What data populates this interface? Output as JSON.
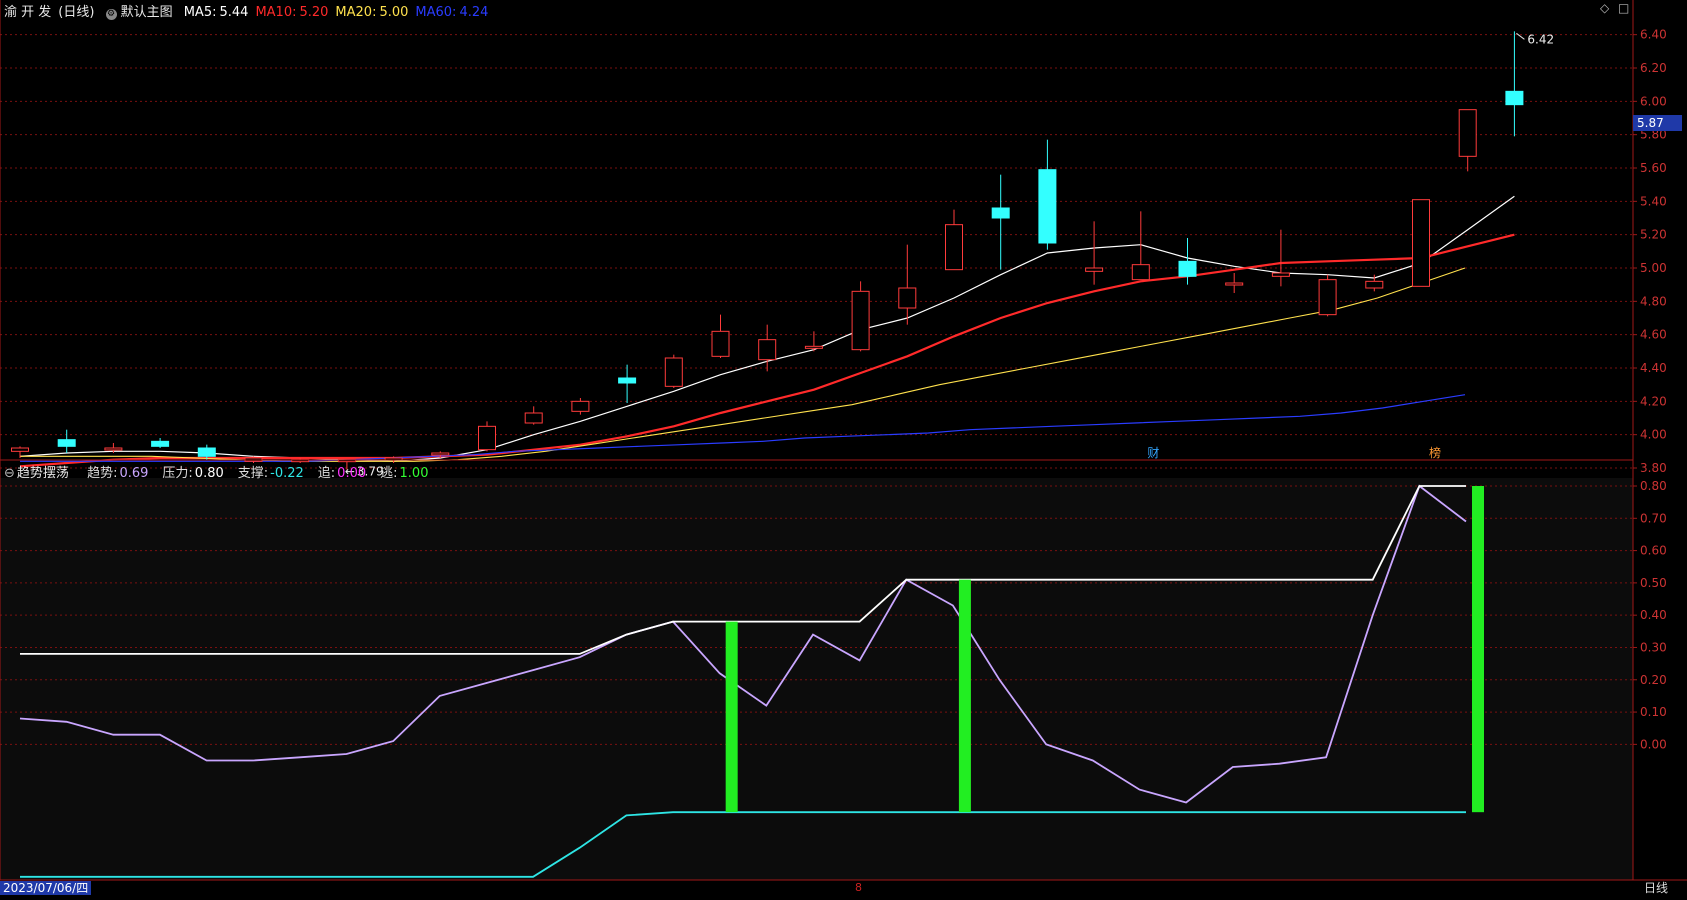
{
  "header": {
    "stock_name": "渝 开 发",
    "period": "(日线)",
    "template": "默认主图",
    "ma": [
      {
        "label": "MA5:",
        "value": "5.44",
        "color": "#ffffff"
      },
      {
        "label": "MA10:",
        "value": "5.20",
        "color": "#ff2a2a"
      },
      {
        "label": "MA20:",
        "value": "5.00",
        "color": "#ffe14d"
      },
      {
        "label": "MA60:",
        "value": "4.24",
        "color": "#2a3cff"
      }
    ]
  },
  "indicator_header": {
    "name": "趋势摆荡",
    "items": [
      {
        "label": "趋势:",
        "value": "0.69",
        "color": "#c9a6ff"
      },
      {
        "label": "压力:",
        "value": "0.80",
        "color": "#ffffff"
      },
      {
        "label": "支撑:",
        "value": "-0.22",
        "color": "#2ee6e6"
      },
      {
        "label": "追:",
        "value": "0.00",
        "color": "#ff33ff"
      },
      {
        "label": "逃:",
        "value": "1.00",
        "color": "#33ff33"
      }
    ]
  },
  "bottom_bar": {
    "date": "2023/07/06/四",
    "mid_label": "8",
    "period_button": "日线"
  },
  "window_icons": {
    "diamond": "◇",
    "square": "□"
  },
  "colors": {
    "up": "#ff3b3b",
    "down": "#33ffff",
    "bg": "#000000",
    "sub_bg": "#0c0c0c",
    "grid": "#7a1010"
  },
  "chart_data": [
    {
      "type": "candlestick",
      "title": "",
      "ylim": [
        3.74,
        6.5
      ],
      "y_ticks": [
        "6.40",
        "6.20",
        "6.00",
        "5.80",
        "5.60",
        "5.40",
        "5.20",
        "5.00",
        "4.80",
        "4.60",
        "4.40",
        "4.20",
        "4.00",
        "3.80"
      ],
      "current_price": "5.87",
      "annotations": [
        {
          "text": "6.42",
          "type": "high_marker"
        },
        {
          "text": "3.79",
          "type": "low_marker"
        },
        {
          "text": "财",
          "type": "event"
        },
        {
          "text": "榜",
          "type": "event"
        }
      ],
      "candles": [
        {
          "o": 3.9,
          "h": 3.93,
          "l": 3.86,
          "c": 3.92
        },
        {
          "o": 3.97,
          "h": 4.03,
          "l": 3.89,
          "c": 3.93
        },
        {
          "o": 3.91,
          "h": 3.95,
          "l": 3.89,
          "c": 3.92
        },
        {
          "o": 3.96,
          "h": 3.98,
          "l": 3.92,
          "c": 3.93
        },
        {
          "o": 3.92,
          "h": 3.94,
          "l": 3.85,
          "c": 3.87
        },
        {
          "o": 3.84,
          "h": 3.87,
          "l": 3.83,
          "c": 3.86
        },
        {
          "o": 3.85,
          "h": 3.86,
          "l": 3.83,
          "c": 3.85
        },
        {
          "o": 3.84,
          "h": 3.85,
          "l": 3.79,
          "c": 3.85
        },
        {
          "o": 3.85,
          "h": 3.87,
          "l": 3.83,
          "c": 3.86
        },
        {
          "o": 3.88,
          "h": 3.9,
          "l": 3.86,
          "c": 3.89
        },
        {
          "o": 3.91,
          "h": 4.08,
          "l": 3.9,
          "c": 4.05
        },
        {
          "o": 4.07,
          "h": 4.17,
          "l": 4.06,
          "c": 4.13
        },
        {
          "o": 4.14,
          "h": 4.22,
          "l": 4.12,
          "c": 4.2
        },
        {
          "o": 4.34,
          "h": 4.42,
          "l": 4.19,
          "c": 4.31
        },
        {
          "o": 4.29,
          "h": 4.48,
          "l": 4.28,
          "c": 4.46
        },
        {
          "o": 4.47,
          "h": 4.72,
          "l": 4.46,
          "c": 4.62
        },
        {
          "o": 4.45,
          "h": 4.66,
          "l": 4.38,
          "c": 4.57
        },
        {
          "o": 4.52,
          "h": 4.62,
          "l": 4.5,
          "c": 4.53
        },
        {
          "o": 4.51,
          "h": 4.92,
          "l": 4.5,
          "c": 4.86
        },
        {
          "o": 4.76,
          "h": 5.14,
          "l": 4.66,
          "c": 4.88
        },
        {
          "o": 4.99,
          "h": 5.35,
          "l": 4.99,
          "c": 5.26
        },
        {
          "o": 5.36,
          "h": 5.56,
          "l": 4.99,
          "c": 5.3
        },
        {
          "o": 5.59,
          "h": 5.77,
          "l": 5.11,
          "c": 5.15
        },
        {
          "o": 4.98,
          "h": 5.28,
          "l": 4.9,
          "c": 5.0
        },
        {
          "o": 4.93,
          "h": 5.34,
          "l": 4.93,
          "c": 5.02
        },
        {
          "o": 5.04,
          "h": 5.18,
          "l": 4.9,
          "c": 4.95
        },
        {
          "o": 4.91,
          "h": 4.97,
          "l": 4.85,
          "c": 4.91
        },
        {
          "o": 4.95,
          "h": 5.23,
          "l": 4.89,
          "c": 4.97
        },
        {
          "o": 4.72,
          "h": 4.96,
          "l": 4.71,
          "c": 4.93
        },
        {
          "o": 4.88,
          "h": 4.96,
          "l": 4.86,
          "c": 4.92
        },
        {
          "o": 4.89,
          "h": 5.41,
          "l": 4.89,
          "c": 5.41
        },
        {
          "o": 5.67,
          "h": 5.95,
          "l": 5.58,
          "c": 5.95
        },
        {
          "o": 6.06,
          "h": 6.42,
          "l": 5.79,
          "c": 5.98
        }
      ],
      "series": [
        {
          "name": "MA5",
          "color": "#ffffff",
          "width": 1.2,
          "values": [
            3.87,
            3.89,
            3.9,
            3.9,
            3.89,
            3.87,
            3.86,
            3.85,
            3.84,
            3.86,
            3.91,
            4.0,
            4.08,
            4.17,
            4.26,
            4.36,
            4.44,
            4.51,
            4.63,
            4.7,
            4.82,
            4.96,
            5.09,
            5.12,
            5.14,
            5.06,
            5.01,
            4.97,
            4.96,
            4.94,
            5.03,
            5.23,
            5.43
          ]
        },
        {
          "name": "MA10",
          "color": "#ff2a2a",
          "width": 2.2,
          "values": [
            3.81,
            3.83,
            3.85,
            3.86,
            3.86,
            3.86,
            3.86,
            3.86,
            3.86,
            3.87,
            3.88,
            3.91,
            3.94,
            3.99,
            4.05,
            4.13,
            4.2,
            4.27,
            4.37,
            4.47,
            4.59,
            4.7,
            4.79,
            4.86,
            4.92,
            4.95,
            4.99,
            5.03,
            5.04,
            5.05,
            5.06,
            5.13,
            5.2
          ]
        },
        {
          "name": "MA20",
          "color": "#ffe14d",
          "width": 1.1,
          "values": [
            3.87,
            3.87,
            3.87,
            3.87,
            3.86,
            3.85,
            3.84,
            3.84,
            3.84,
            3.84,
            3.85,
            3.87,
            3.9,
            3.94,
            3.98,
            4.02,
            4.06,
            4.1,
            4.14,
            4.18,
            4.24,
            4.3,
            4.35,
            4.4,
            4.45,
            4.5,
            4.55,
            4.6,
            4.65,
            4.7,
            4.75,
            4.82,
            4.91,
            5.0
          ]
        },
        {
          "name": "MA60",
          "color": "#2a3cff",
          "width": 1.2,
          "values": [
            3.84,
            3.84,
            3.84,
            3.84,
            3.84,
            3.84,
            3.84,
            3.84,
            3.85,
            3.86,
            3.87,
            3.88,
            3.9,
            3.91,
            3.92,
            3.93,
            3.94,
            3.95,
            3.96,
            3.98,
            3.99,
            4.0,
            4.01,
            4.03,
            4.04,
            4.05,
            4.06,
            4.07,
            4.08,
            4.09,
            4.1,
            4.11,
            4.13,
            4.16,
            4.2,
            4.24
          ]
        }
      ]
    },
    {
      "type": "line",
      "title": "",
      "ylim": [
        -0.42,
        0.8
      ],
      "y_ticks": [
        "0.80",
        "0.70",
        "0.60",
        "0.50",
        "0.40",
        "0.30",
        "0.20",
        "0.10",
        "0.00"
      ],
      "series": [
        {
          "name": "趋势",
          "color": "#c9a6ff",
          "values": [
            0.08,
            0.07,
            0.03,
            0.03,
            -0.05,
            -0.05,
            -0.04,
            -0.03,
            0.01,
            0.15,
            0.19,
            0.23,
            0.27,
            0.34,
            0.38,
            0.22,
            0.12,
            0.34,
            0.26,
            0.51,
            0.43,
            0.2,
            0.0,
            -0.05,
            -0.14,
            -0.18,
            -0.07,
            -0.06,
            -0.04,
            0.4,
            0.8,
            0.69
          ]
        },
        {
          "name": "压力",
          "color": "#ffffff",
          "values": [
            0.28,
            0.28,
            0.28,
            0.28,
            0.28,
            0.28,
            0.28,
            0.28,
            0.28,
            0.28,
            0.28,
            0.28,
            0.28,
            0.34,
            0.38,
            0.38,
            0.38,
            0.38,
            0.38,
            0.51,
            0.51,
            0.51,
            0.51,
            0.51,
            0.51,
            0.51,
            0.51,
            0.51,
            0.51,
            0.51,
            0.8,
            0.8
          ]
        },
        {
          "name": "支撑",
          "color": "#2ee6e6",
          "values": [
            -0.41,
            -0.41,
            -0.41,
            -0.41,
            -0.41,
            -0.41,
            -0.41,
            -0.41,
            -0.41,
            -0.41,
            -0.41,
            -0.41,
            -0.32,
            -0.22,
            -0.21,
            -0.21,
            -0.21,
            -0.21,
            -0.21,
            -0.21,
            -0.21,
            -0.21,
            -0.21,
            -0.21,
            -0.21,
            -0.21,
            -0.21,
            -0.21,
            -0.21,
            -0.21,
            -0.21,
            -0.21
          ]
        }
      ],
      "signals": [
        {
          "name": "逃",
          "index": 15,
          "top": 0.38,
          "bottom": -0.21
        },
        {
          "name": "逃",
          "index": 20,
          "top": 0.51,
          "bottom": -0.21
        },
        {
          "name": "逃",
          "index": 31,
          "top": 0.8,
          "bottom": -0.21
        }
      ]
    }
  ]
}
